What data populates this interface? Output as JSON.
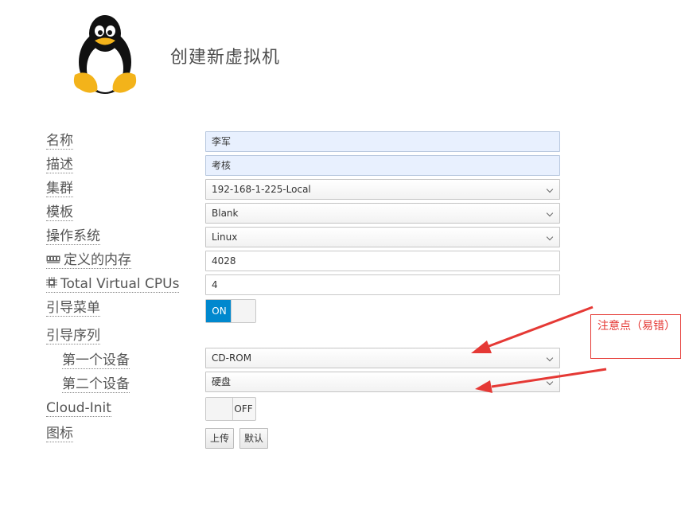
{
  "header": {
    "title": "创建新虚拟机"
  },
  "form": {
    "name": {
      "label": "名称",
      "value": "李军"
    },
    "description": {
      "label": "描述",
      "value": "考核"
    },
    "cluster": {
      "label": "集群",
      "value": "192-168-1-225-Local"
    },
    "template": {
      "label": "模板",
      "value": "Blank"
    },
    "os": {
      "label": "操作系统",
      "value": "Linux"
    },
    "memory": {
      "label": "定义的内存",
      "value": "4028"
    },
    "cpus": {
      "label": "Total Virtual CPUs",
      "value": "4"
    },
    "boot_menu": {
      "label": "引导菜单",
      "state": "ON"
    },
    "boot_sequence": {
      "label": "引导序列"
    },
    "first_device": {
      "label": "第一个设备",
      "value": "CD-ROM"
    },
    "second_device": {
      "label": "第二个设备",
      "value": "硬盘"
    },
    "cloud_init": {
      "label": "Cloud-Init",
      "state": "OFF"
    },
    "icon": {
      "label": "图标",
      "upload_label": "上传",
      "default_label": "默认"
    }
  },
  "annotation": {
    "text": "注意点（易错）",
    "color": "#e53935"
  },
  "colors": {
    "toggle_on": "#0088ce",
    "filled_field": "#e8f0fe"
  }
}
